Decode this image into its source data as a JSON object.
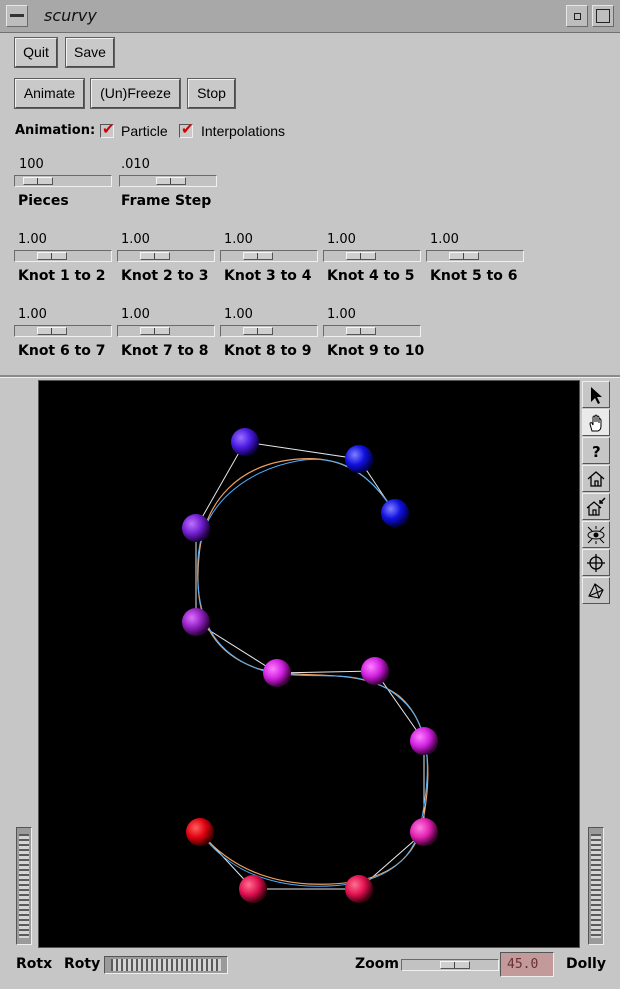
{
  "window": {
    "title": "scurvy"
  },
  "buttons": {
    "quit": "Quit",
    "save": "Save",
    "animate": "Animate",
    "unfreeze": "(Un)Freeze",
    "stop": "Stop"
  },
  "animation": {
    "label": "Animation:",
    "particle": {
      "label": "Particle",
      "checked": true
    },
    "interpolations": {
      "label": "Interpolations",
      "checked": true
    }
  },
  "sliders": {
    "pieces": {
      "label": "Pieces",
      "value": "100"
    },
    "frame_step": {
      "label": "Frame Step",
      "value": ".010"
    },
    "knots": [
      {
        "label": "Knot 1 to 2",
        "value": "1.00"
      },
      {
        "label": "Knot 2 to 3",
        "value": "1.00"
      },
      {
        "label": "Knot 3 to 4",
        "value": "1.00"
      },
      {
        "label": "Knot 4 to 5",
        "value": "1.00"
      },
      {
        "label": "Knot 5 to 6",
        "value": "1.00"
      },
      {
        "label": "Knot 6 to 7",
        "value": "1.00"
      },
      {
        "label": "Knot 7 to 8",
        "value": "1.00"
      },
      {
        "label": "Knot 8 to 9",
        "value": "1.00"
      },
      {
        "label": "Knot 9 to 10",
        "value": "1.00"
      }
    ]
  },
  "viewer": {
    "background": "#000000",
    "tools": [
      "pointer-icon",
      "hand-icon",
      "help-icon",
      "home-icon",
      "set-home-icon",
      "view-all-icon",
      "seek-icon",
      "projection-icon"
    ]
  },
  "bottom": {
    "rotx": "Rotx",
    "roty": "Roty",
    "zoom_label": "Zoom",
    "zoom_value": "45.0",
    "dolly": "Dolly"
  },
  "colors": {
    "accent_check": "#d40000",
    "zoom_field": "#c29a9a"
  }
}
